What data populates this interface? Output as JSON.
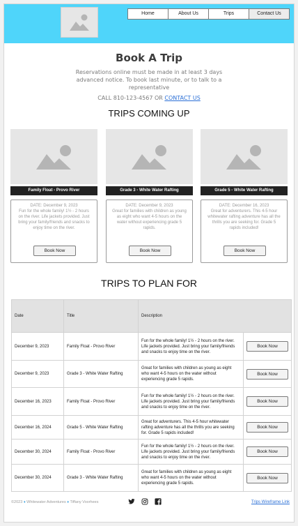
{
  "nav": {
    "items": [
      {
        "label": "Home",
        "active": false
      },
      {
        "label": "About Us",
        "active": false
      },
      {
        "label": "Trips",
        "active": false
      },
      {
        "label": "Contact Us",
        "active": true
      }
    ]
  },
  "main": {
    "title": "Book A Trip",
    "intro": "Reservations online must be made in at least 3 days advanced notice.  To book last minute, or to talk to a representative",
    "call_prefix": "CALL 810-123-4567 OR ",
    "contact_link": "CONTACT US"
  },
  "upcoming": {
    "heading": "TRIPS COMING UP",
    "cards": [
      {
        "title": "Family Float - Provo River",
        "date": "DATE: December 9, 2023",
        "description": "Fun for the whole family! 1½ - 2 hours on the river. Life jackets provided. Just bring your family/friends and snacks to enjoy time on the river.",
        "button": "Book Now"
      },
      {
        "title": "Grade 3 - White Water Rafting",
        "date": "DATE: December 9, 2023",
        "description": "Great for families with children as young as eight who want 4-5 hours on the water without experiencing grade 5 rapids.",
        "button": "Book Now"
      },
      {
        "title": "Grade 5 - White Water Rafting",
        "date": "DATE: December 16, 2023",
        "description": "Great for adventurers.  This 4-5 hour whitewater rafting adventure has all the thrills you are seeking for.  Grade 5 rapids included!",
        "button": "Book Now"
      }
    ]
  },
  "plan": {
    "heading": "TRIPS TO PLAN FOR",
    "columns": [
      "Date",
      "Title",
      "Description"
    ],
    "rows": [
      {
        "date": "December 9, 2023",
        "title": "Family Float - Provo River",
        "description": "Fun for the whole family! 1½ - 2 hours on the river. Life jackets provided. Just bring your family/friends and snacks to enjoy time on the river.",
        "button": "Book Now"
      },
      {
        "date": "December 9, 2023",
        "title": "Grade 3 - White Water Rafting",
        "description": "Great for families with children as young as eight who want 4-5 hours on the water without experiencing grade 5 rapids.",
        "button": "Book Now"
      },
      {
        "date": "December 16, 2023",
        "title": "Family Float - Provo River",
        "description": "Fun for the whole family! 1½ - 2 hours on the river. Life jackets provided. Just bring your family/friends and snacks to enjoy time on the river.",
        "button": "Book Now"
      },
      {
        "date": "December 16, 2024",
        "title": "Grade 5 - White Water Rafting",
        "description": "Great for adventurers.  This 4-5 hour whitewater rafting adventure has all the thrills you are seeking for.  Grade 5 rapids included!",
        "button": "Book Now"
      },
      {
        "date": "December 30, 2024",
        "title": "Family Float - Provo River",
        "description": "Fun for the whole family! 1½ - 2 hours on the river. Life jackets provided. Just bring your family/friends and snacks to enjoy time on the river.",
        "button": "Book Now"
      },
      {
        "date": "December 30, 2024",
        "title": "Grade 3 - White Water Rafting",
        "description": "Great for families with children as young as eight who want 4-5 hours on the water without experiencing grade 5 rapids.",
        "button": "Book Now"
      }
    ]
  },
  "footer": {
    "copyright": "©2023",
    "brand": "Whitewater Adventures",
    "author": "Tiffany Voorhees",
    "link": "Trips Wireframe Link",
    "social_icons": [
      "twitter-icon",
      "instagram-icon",
      "facebook-icon"
    ]
  },
  "colors": {
    "header_bg": "#4fd5fa",
    "link": "#2a6fd6",
    "card_title_bg": "#222222"
  }
}
